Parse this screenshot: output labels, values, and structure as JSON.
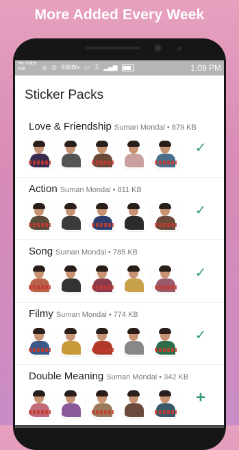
{
  "promo": {
    "headline": "More Added Every Week"
  },
  "status_bar": {
    "carrier": "No video call",
    "speed": "8388/s",
    "time": "1:09 PM"
  },
  "app": {
    "title": "Sticker Packs"
  },
  "packs": [
    {
      "name": "Love & Friendship",
      "author": "Suman Mondal",
      "size": "879 KB",
      "state": "added",
      "state_icon": "check-icon",
      "palette": [
        "#3a2a4e",
        "#555",
        "#6b4a3a",
        "#c9a0a0",
        "#4a6f8a"
      ]
    },
    {
      "name": "Action",
      "author": "Suman Mondal",
      "size": "811 KB",
      "state": "added",
      "state_icon": "check-icon",
      "palette": [
        "#5a4a3a",
        "#3b3b3b",
        "#2d3e6e",
        "#2b2b2b",
        "#6a4a3a"
      ]
    },
    {
      "name": "Song",
      "author": "Suman Mondal",
      "size": "785 KB",
      "state": "added",
      "state_icon": "check-icon",
      "palette": [
        "#b8624a",
        "#333",
        "#8a3a4a",
        "#c8a04a",
        "#9a5a6a"
      ]
    },
    {
      "name": "Filmy",
      "author": "Suman Mondal",
      "size": "774 KB",
      "state": "added",
      "state_icon": "check-icon",
      "palette": [
        "#3a5a8a",
        "#c89a3a",
        "#b03a2a",
        "#888",
        "#2e6e4a"
      ]
    },
    {
      "name": "Double Meaning",
      "author": "Suman Mondal",
      "size": "342 KB",
      "state": "not_added",
      "state_icon": "plus-icon",
      "palette": [
        "#c06a7a",
        "#8a5a9a",
        "#9a7a5a",
        "#6a4a3a",
        "#3a5a6a"
      ]
    }
  ],
  "colors": {
    "accent": "#3a9e74",
    "status_bar": "#b5b5b5"
  }
}
